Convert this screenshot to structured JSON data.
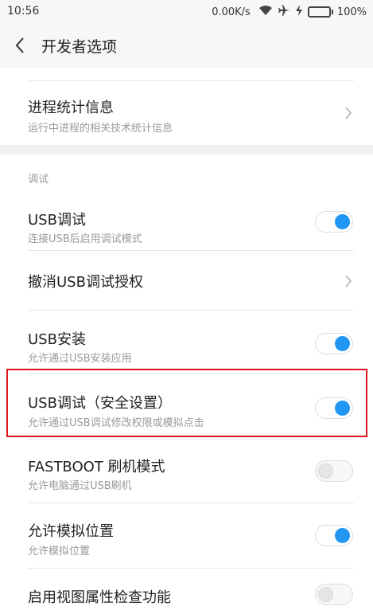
{
  "status_bar": {
    "time": "10:56",
    "network_speed": "0.00K/s",
    "icons": [
      "wifi-icon",
      "airplane-icon",
      "charging-icon"
    ],
    "battery": "100%",
    "battery_level": 1.0
  },
  "header": {
    "title": "开发者选项",
    "back_icon": "chevron-left-icon"
  },
  "list": {
    "process_stats": {
      "title": "进程统计信息",
      "subtitle": "运行中进程的相关技术统计信息"
    },
    "section_debug": "调试",
    "usb_debug": {
      "title": "USB调试",
      "subtitle": "连接USB后启用调试模式",
      "enabled": true
    },
    "revoke_usb": {
      "title": "撤消USB调试授权"
    },
    "usb_install": {
      "title": "USB安装",
      "subtitle": "允许通过USB安装应用",
      "enabled": true
    },
    "usb_debug_secure": {
      "title": "USB调试（安全设置）",
      "subtitle": "允许通过USB调试修改权限或模拟点击",
      "enabled": true
    },
    "fastboot": {
      "title": "FASTBOOT 刷机模式",
      "subtitle": "允许电脑通过USB刷机",
      "enabled": false
    },
    "mock_location": {
      "title": "允许模拟位置",
      "subtitle": "允许模拟位置",
      "enabled": true
    },
    "view_attr": {
      "title": "启用视图属性检查功能",
      "enabled": false
    }
  },
  "colors": {
    "accent": "#2196f3",
    "highlight_border": "#e0141c",
    "background": "#f7f7f7"
  }
}
